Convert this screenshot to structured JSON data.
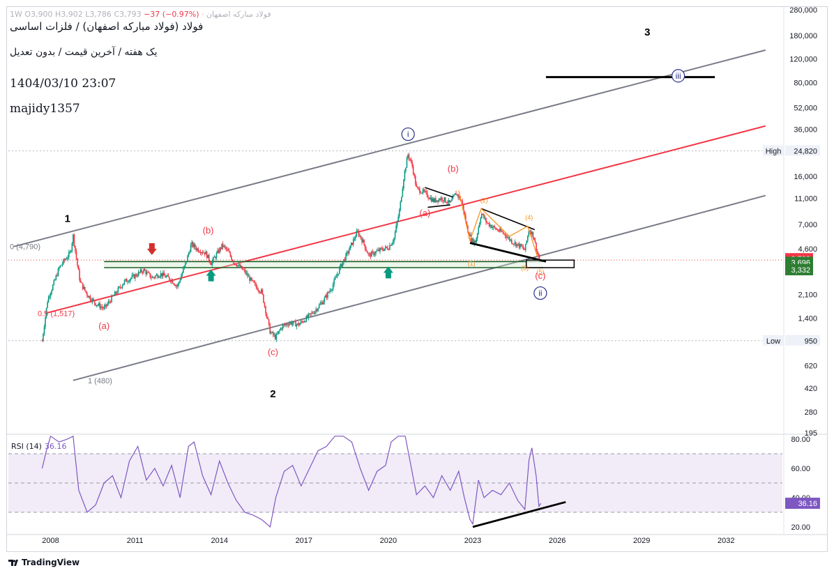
{
  "header": {
    "ohlc_prefix": "فولاد مبارکه اصفهان · 1W",
    "open": "O3,900",
    "high": "H3,902",
    "low": "L3,786",
    "close": "C3,793",
    "change": "−37 (−0.97%)",
    "title": "فولاد (فولاد مبارکه اصفهان) / فلزات اساسی",
    "subtitle": "یک هفته / آخرین قیمت / بدون تعدیل",
    "datetime": "1404/03/10 23:07",
    "author": "majidy1357"
  },
  "footer": {
    "brand": "TradingView"
  },
  "colors": {
    "candle_up": "#089981",
    "candle_down": "#f23645",
    "channel": "#787b86",
    "midline": "#f23645",
    "support": "#1b5e20",
    "rsi": "#7e57c2",
    "rsi_band": "#ede7f6",
    "wave_red": "#f23645",
    "wave_orange": "#f7931e",
    "wave_blue": "#2a2e8b",
    "arrow_green": "#089981",
    "arrow_red": "#d32f2f"
  },
  "chart_data": [
    {
      "type": "candlestick",
      "timeframe": "1W",
      "scale": "log",
      "ylim": [
        195,
        280000
      ],
      "xlim": [
        2006.5,
        2034.0
      ],
      "x_ticks": [
        "2008",
        "2011",
        "2014",
        "2017",
        "2020",
        "2023",
        "2026",
        "2029",
        "2032"
      ],
      "y_ticks": [
        "280,000",
        "180,000",
        "120,000",
        "80,000",
        "52,000",
        "36,000",
        "24,820",
        "16,000",
        "11,000",
        "7,000",
        "4,600",
        "3,793",
        "3,696",
        "3,332",
        "2,100",
        "1,400",
        "950",
        "620",
        "420",
        "280",
        "195"
      ],
      "price_path": [
        [
          2007.7,
          950
        ],
        [
          2007.9,
          1950
        ],
        [
          2008.1,
          2500
        ],
        [
          2008.3,
          3300
        ],
        [
          2008.5,
          3800
        ],
        [
          2008.7,
          4300
        ],
        [
          2008.8,
          5800
        ],
        [
          2008.95,
          3500
        ],
        [
          2009.05,
          2600
        ],
        [
          2009.3,
          2100
        ],
        [
          2009.6,
          1800
        ],
        [
          2009.9,
          1650
        ],
        [
          2010.2,
          2000
        ],
        [
          2010.6,
          2600
        ],
        [
          2011.0,
          2900
        ],
        [
          2011.3,
          3200
        ],
        [
          2011.6,
          2800
        ],
        [
          2011.9,
          3000
        ],
        [
          2012.3,
          2700
        ],
        [
          2012.5,
          2400
        ],
        [
          2012.8,
          3600
        ],
        [
          2013.0,
          5000
        ],
        [
          2013.2,
          4600
        ],
        [
          2013.5,
          4300
        ],
        [
          2013.7,
          3600
        ],
        [
          2013.9,
          4200
        ],
        [
          2014.1,
          4900
        ],
        [
          2014.3,
          4400
        ],
        [
          2014.5,
          3700
        ],
        [
          2014.7,
          3400
        ],
        [
          2014.9,
          3100
        ],
        [
          2015.1,
          2700
        ],
        [
          2015.3,
          2400
        ],
        [
          2015.5,
          2200
        ],
        [
          2015.8,
          1100
        ],
        [
          2016.0,
          1000
        ],
        [
          2016.2,
          1200
        ],
        [
          2016.5,
          1300
        ],
        [
          2016.8,
          1250
        ],
        [
          2017.1,
          1400
        ],
        [
          2017.4,
          1600
        ],
        [
          2017.7,
          1900
        ],
        [
          2018.0,
          2400
        ],
        [
          2018.3,
          3400
        ],
        [
          2018.6,
          4500
        ],
        [
          2018.9,
          6200
        ],
        [
          2019.1,
          5200
        ],
        [
          2019.3,
          4100
        ],
        [
          2019.6,
          4400
        ],
        [
          2019.8,
          4600
        ],
        [
          2020.0,
          4700
        ],
        [
          2020.2,
          5500
        ],
        [
          2020.4,
          9000
        ],
        [
          2020.55,
          16000
        ],
        [
          2020.7,
          23500
        ],
        [
          2020.85,
          19000
        ],
        [
          2021.0,
          13000
        ],
        [
          2021.3,
          12000
        ],
        [
          2021.6,
          10500
        ],
        [
          2021.9,
          11000
        ],
        [
          2022.2,
          10000
        ],
        [
          2022.4,
          12000
        ],
        [
          2022.6,
          10500
        ],
        [
          2022.8,
          6500
        ],
        [
          2022.95,
          5300
        ],
        [
          2023.1,
          5200
        ],
        [
          2023.3,
          8500
        ],
        [
          2023.5,
          7200
        ],
        [
          2023.8,
          6500
        ],
        [
          2024.1,
          6000
        ],
        [
          2024.4,
          5200
        ],
        [
          2024.7,
          4800
        ],
        [
          2024.85,
          4500
        ],
        [
          2025.0,
          6500
        ],
        [
          2025.15,
          5800
        ],
        [
          2025.3,
          4200
        ],
        [
          2025.4,
          3793
        ]
      ],
      "levels": [
        {
          "label": "High",
          "value": 24820
        },
        {
          "label": "Low",
          "value": 950
        },
        {
          "label": "last",
          "value": 3793
        },
        {
          "label": "support_upper",
          "value": 3696
        },
        {
          "label": "support_lower",
          "value": 3332
        }
      ],
      "channel_labels": [
        "0 (4,790)",
        "0.5 (1,517)",
        "1 (480)"
      ],
      "wave_labels": {
        "major": [
          "1",
          "2",
          "3"
        ],
        "circled": [
          "i",
          "ii",
          "iii"
        ],
        "corrective": [
          "(a)",
          "(b)",
          "(c)",
          "(b)",
          "(a)",
          "(b)",
          "(c)"
        ],
        "impulse": [
          "(1)",
          "(2)",
          "(3)",
          "(4)",
          "(5)"
        ]
      }
    },
    {
      "type": "line",
      "name": "RSI (14)",
      "last_value": "36.16",
      "ylim": [
        15,
        82
      ],
      "y_ticks": [
        "80.00",
        "60.00",
        "40.00",
        "20.00"
      ],
      "bands": [
        30,
        50,
        70
      ],
      "path": [
        [
          2007.7,
          60
        ],
        [
          2007.85,
          72
        ],
        [
          2008.0,
          82
        ],
        [
          2008.3,
          78
        ],
        [
          2008.6,
          80
        ],
        [
          2008.8,
          82
        ],
        [
          2009.0,
          45
        ],
        [
          2009.3,
          30
        ],
        [
          2009.6,
          35
        ],
        [
          2009.9,
          50
        ],
        [
          2010.2,
          55
        ],
        [
          2010.5,
          40
        ],
        [
          2010.8,
          65
        ],
        [
          2011.1,
          75
        ],
        [
          2011.4,
          52
        ],
        [
          2011.7,
          60
        ],
        [
          2012.0,
          48
        ],
        [
          2012.3,
          62
        ],
        [
          2012.6,
          40
        ],
        [
          2012.9,
          75
        ],
        [
          2013.1,
          78
        ],
        [
          2013.4,
          55
        ],
        [
          2013.7,
          42
        ],
        [
          2014.0,
          65
        ],
        [
          2014.3,
          50
        ],
        [
          2014.6,
          38
        ],
        [
          2014.9,
          30
        ],
        [
          2015.2,
          28
        ],
        [
          2015.5,
          25
        ],
        [
          2015.8,
          20
        ],
        [
          2016.0,
          40
        ],
        [
          2016.3,
          58
        ],
        [
          2016.6,
          62
        ],
        [
          2016.9,
          48
        ],
        [
          2017.2,
          60
        ],
        [
          2017.5,
          72
        ],
        [
          2017.8,
          75
        ],
        [
          2018.1,
          82
        ],
        [
          2018.4,
          82
        ],
        [
          2018.7,
          78
        ],
        [
          2019.0,
          60
        ],
        [
          2019.3,
          45
        ],
        [
          2019.6,
          58
        ],
        [
          2019.9,
          62
        ],
        [
          2020.1,
          78
        ],
        [
          2020.35,
          82
        ],
        [
          2020.6,
          82
        ],
        [
          2020.8,
          62
        ],
        [
          2021.0,
          42
        ],
        [
          2021.3,
          48
        ],
        [
          2021.6,
          40
        ],
        [
          2021.9,
          55
        ],
        [
          2022.2,
          45
        ],
        [
          2022.5,
          58
        ],
        [
          2022.7,
          40
        ],
        [
          2022.9,
          25
        ],
        [
          2023.0,
          22
        ],
        [
          2023.2,
          52
        ],
        [
          2023.4,
          40
        ],
        [
          2023.7,
          45
        ],
        [
          2024.0,
          42
        ],
        [
          2024.3,
          50
        ],
        [
          2024.6,
          38
        ],
        [
          2024.85,
          32
        ],
        [
          2025.0,
          66
        ],
        [
          2025.1,
          74
        ],
        [
          2025.25,
          55
        ],
        [
          2025.35,
          34
        ],
        [
          2025.42,
          36.16
        ]
      ]
    }
  ]
}
